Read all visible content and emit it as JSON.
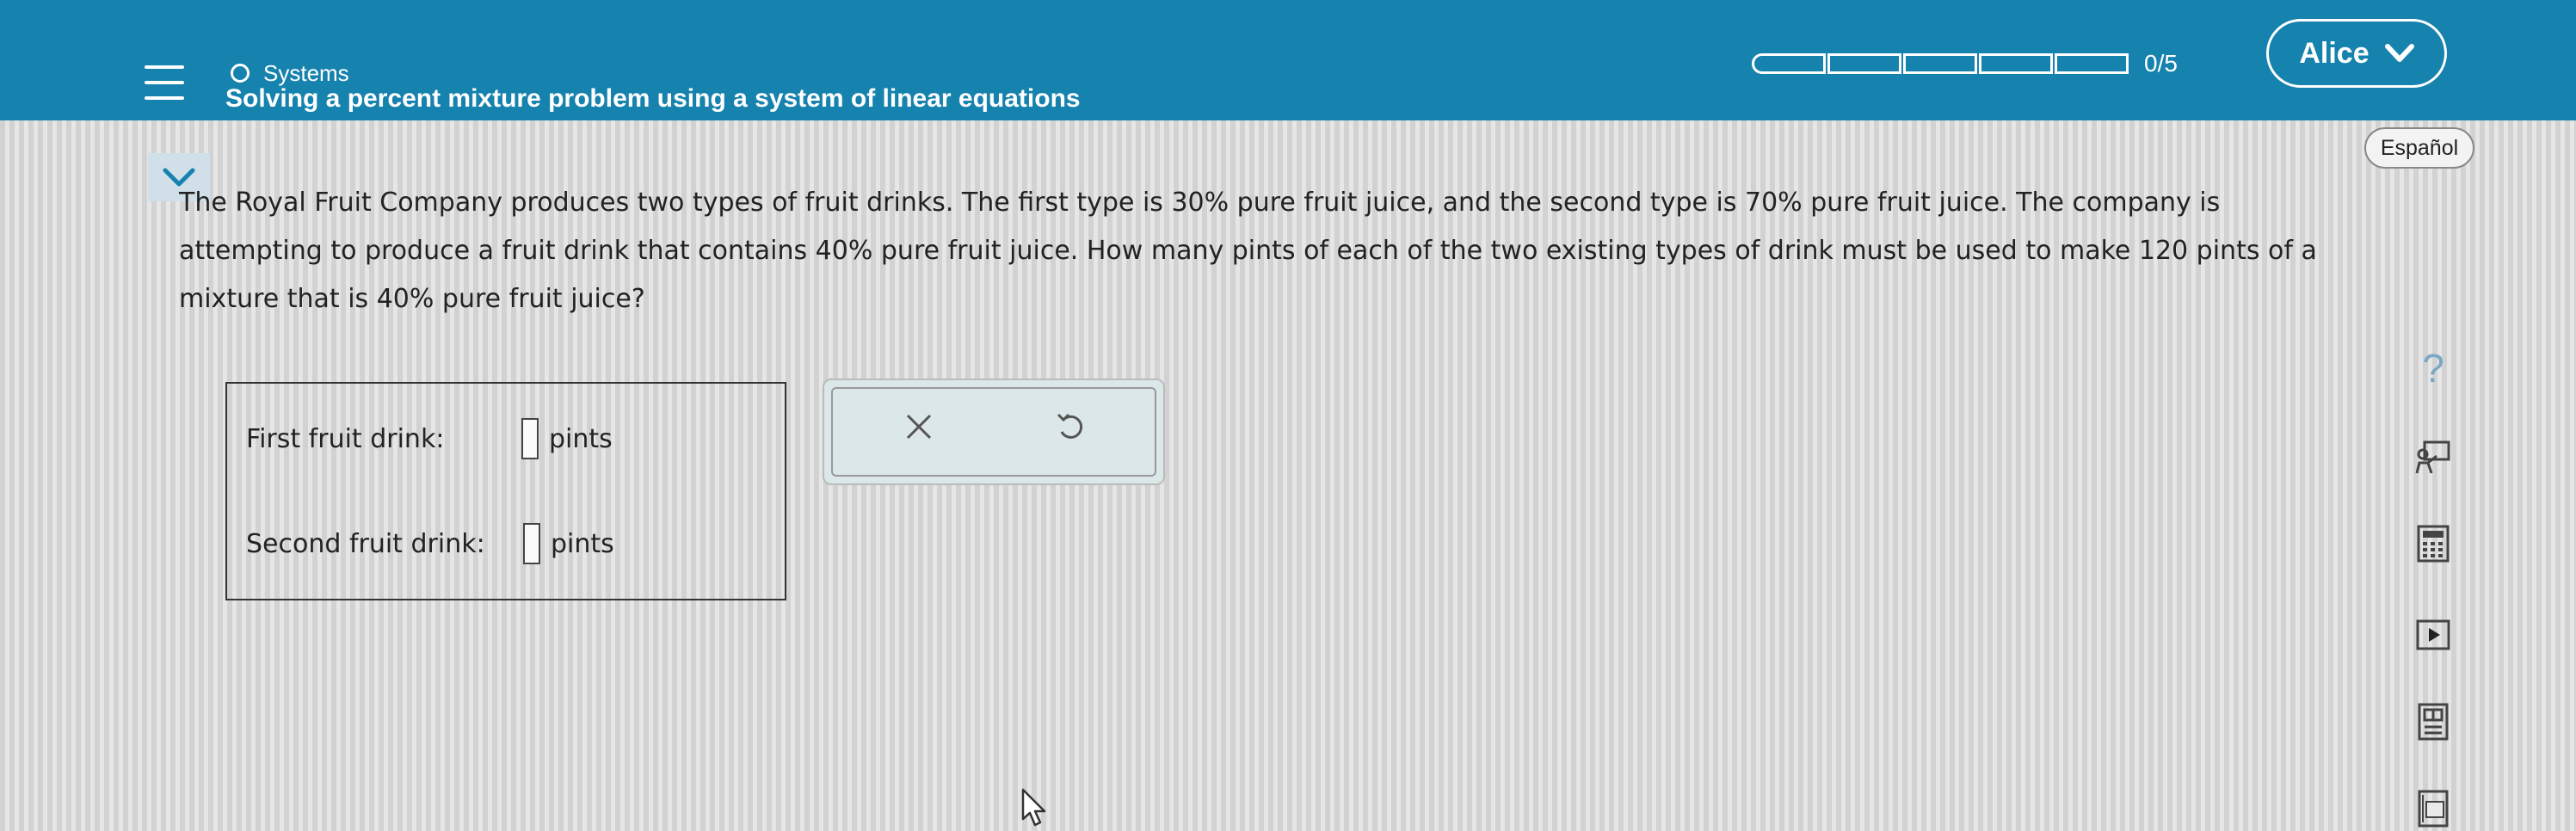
{
  "header": {
    "breadcrumb": "Systems",
    "title": "Solving a percent mixture problem using a system of linear equations",
    "progress": {
      "completed": 0,
      "total": 5,
      "text": "0/5"
    },
    "user_name": "Alice",
    "language_button": "Español"
  },
  "problem": {
    "text": "The Royal Fruit Company produces two types of fruit drinks. The first type is 30% pure fruit juice, and the second type is 70% pure fruit juice. The company is attempting to produce a fruit drink that contains 40% pure fruit juice. How many pints of each of the two existing types of drink must be used to make 120 pints of a mixture that is 40% pure fruit juice?"
  },
  "answer": {
    "first_label": "First fruit drink:",
    "first_unit": "pints",
    "first_value": "",
    "second_label": "Second fruit drink:",
    "second_unit": "pints",
    "second_value": ""
  },
  "toolbar": {
    "help": "?",
    "icons": [
      "question-icon",
      "teacher-board-icon",
      "calculator-icon",
      "video-play-icon",
      "textbook-icon",
      "dictionary-icon"
    ]
  },
  "colors": {
    "header_bg": "#1682ae",
    "text": "#222222",
    "action_bg": "#dbe7e9"
  }
}
